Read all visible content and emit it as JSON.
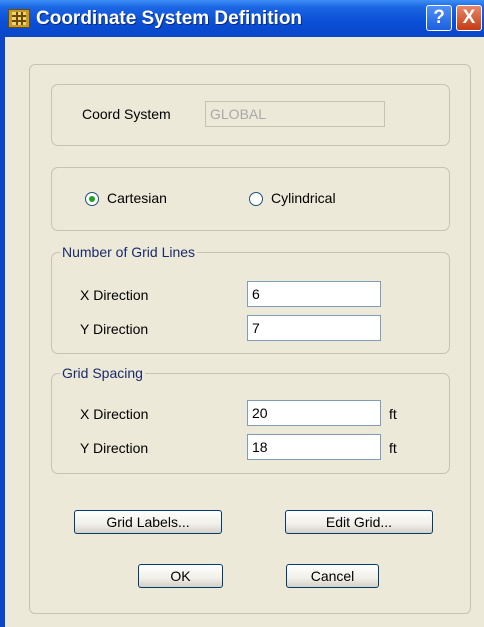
{
  "window": {
    "title": "Coordinate System Definition",
    "help_label": "?",
    "close_label": "X"
  },
  "coord_system": {
    "label": "Coord System",
    "value": "GLOBAL"
  },
  "system_type": {
    "options": [
      {
        "label": "Cartesian",
        "selected": true
      },
      {
        "label": "Cylindrical",
        "selected": false
      }
    ]
  },
  "grid_lines": {
    "legend": "Number of Grid Lines",
    "x_label": "X Direction",
    "x_value": "6",
    "y_label": "Y Direction",
    "y_value": "7"
  },
  "grid_spacing": {
    "legend": "Grid Spacing",
    "x_label": "X Direction",
    "x_value": "20",
    "x_unit": "ft",
    "y_label": "Y Direction",
    "y_value": "18",
    "y_unit": "ft"
  },
  "buttons": {
    "grid_labels": "Grid Labels...",
    "edit_grid": "Edit Grid...",
    "ok": "OK",
    "cancel": "Cancel"
  }
}
